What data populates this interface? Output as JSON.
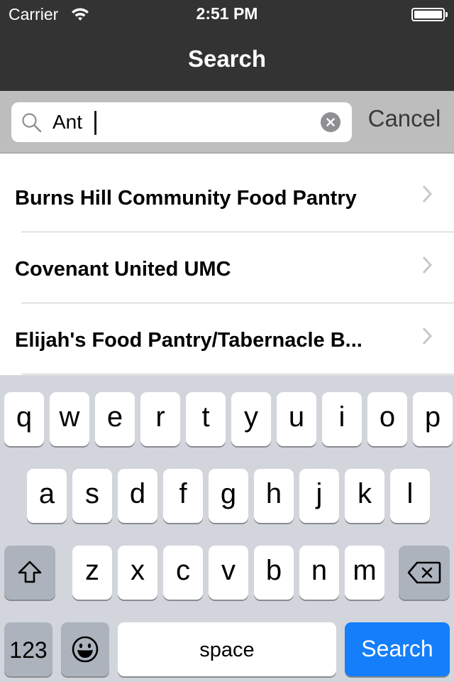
{
  "status_bar": {
    "carrier": "Carrier",
    "time": "2:51 PM",
    "wifi_icon": "wifi-icon",
    "battery_icon": "battery-icon",
    "battery_level": 1.0
  },
  "nav_bar": {
    "title": "Search"
  },
  "search": {
    "value": "Ant",
    "placeholder": "",
    "search_icon": "magnifying-glass-icon",
    "clear_icon": "clear-circle-x-icon",
    "cancel_label": "Cancel"
  },
  "results": [
    {
      "label": "Burns Hill Community Food Pantry",
      "icon": "chevron-right-icon"
    },
    {
      "label": "Covenant United UMC",
      "icon": "chevron-right-icon"
    },
    {
      "label": "Elijah's Food Pantry/Tabernacle B...",
      "icon": "chevron-right-icon"
    }
  ],
  "keyboard": {
    "row1": [
      "q",
      "w",
      "e",
      "r",
      "t",
      "y",
      "u",
      "i",
      "o",
      "p"
    ],
    "row2": [
      "a",
      "s",
      "d",
      "f",
      "g",
      "h",
      "j",
      "k",
      "l"
    ],
    "row3": [
      "z",
      "x",
      "c",
      "v",
      "b",
      "n",
      "m"
    ],
    "shift_icon": "shift-arrow-icon",
    "delete_icon": "backspace-icon",
    "numbers_label": "123",
    "emoji_icon": "emoji-smiley-icon",
    "space_label": "space",
    "return_label": "Search",
    "return_color": "#147efb"
  },
  "colors": {
    "nav_background": "#333333",
    "search_bar_background": "#bdbdbd",
    "keyboard_background": "#d2d5db",
    "accent": "#147efb"
  }
}
